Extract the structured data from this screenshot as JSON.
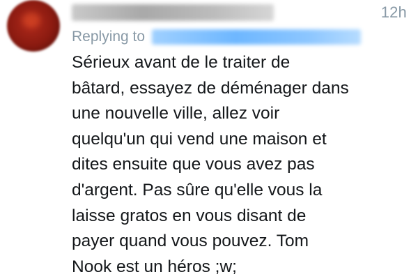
{
  "tweet": {
    "time": "12h",
    "replying_label": "Replying to",
    "lines": [
      "Sérieux avant de le traiter de",
      "bâtard, essayez de déménager dans",
      "une nouvelle ville, allez voir",
      "quelqu'un qui vend une maison et",
      "dites ensuite que vous avez pas",
      "d'argent. Pas sûre qu'elle vous la",
      "laisse gratos en vous disant de",
      "payer quand vous pouvez. Tom",
      "Nook est un héros ;w;"
    ]
  },
  "colors": {
    "secondary_text": "#8899a6",
    "body_text": "#14171a",
    "link_blue": "#6eb7ff"
  }
}
